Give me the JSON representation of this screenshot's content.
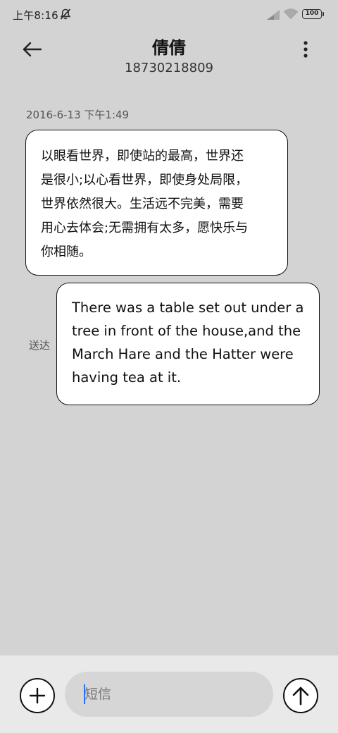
{
  "status_bar": {
    "time": "上午8:16",
    "battery": "100",
    "icons": [
      "mute-icon",
      "signal-icon",
      "wifi-icon",
      "battery-icon"
    ]
  },
  "header": {
    "contact_name": "倩倩",
    "contact_number": "18730218809",
    "icons": [
      "back-arrow-icon",
      "more-vertical-icon"
    ]
  },
  "conversation": {
    "timestamp": "2016-6-13 下午1:49",
    "messages": [
      {
        "direction": "incoming",
        "lines": [
          "以眼看世界，即使站的最高，世界还",
          "是很小;以心看世界，即使身处局限，",
          "世界依然很大。生活远不完美，需要",
          "用心去体会;无需拥有太多，愿快乐与",
          "你相随。"
        ]
      },
      {
        "direction": "outgoing",
        "status": "送达",
        "lines": [
          "There was a table set out under a",
          "tree in front of the house,and the",
          "March Hare and the Hatter were",
          "having tea at it."
        ]
      }
    ]
  },
  "composer": {
    "placeholder": "短信",
    "value": "",
    "icons": [
      "plus-icon",
      "send-arrow-up-icon"
    ]
  },
  "colors": {
    "background": "#d3d3d3",
    "composer_bg": "#e9e9e9",
    "bubble_bg": "#ffffff",
    "caret": "#2a6ef5"
  }
}
